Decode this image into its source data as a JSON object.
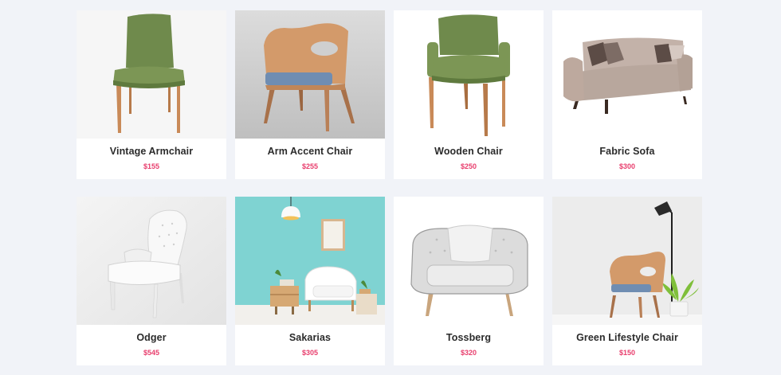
{
  "colors": {
    "page_background": "#f1f3f8",
    "card_background": "#ffffff",
    "price_color": "#e83e6d",
    "name_color": "#2b2b2b"
  },
  "products": [
    {
      "name": "Vintage Armchair",
      "price": "$155",
      "image": "green-armchair-image"
    },
    {
      "name": "Arm Accent Chair",
      "price": "$255",
      "image": "wooden-accent-chair-image"
    },
    {
      "name": "Wooden Chair",
      "price": "$250",
      "image": "green-wooden-chair-image"
    },
    {
      "name": "Fabric Sofa",
      "price": "$300",
      "image": "fabric-sofa-image"
    },
    {
      "name": "Odger",
      "price": "$545",
      "image": "white-tufted-chair-image"
    },
    {
      "name": "Sakarias",
      "price": "$305",
      "image": "living-room-scene-image"
    },
    {
      "name": "Tossberg",
      "price": "$320",
      "image": "grey-tufted-armchair-image"
    },
    {
      "name": "Green Lifestyle Chair",
      "price": "$150",
      "image": "lifestyle-chair-lamp-image"
    }
  ]
}
